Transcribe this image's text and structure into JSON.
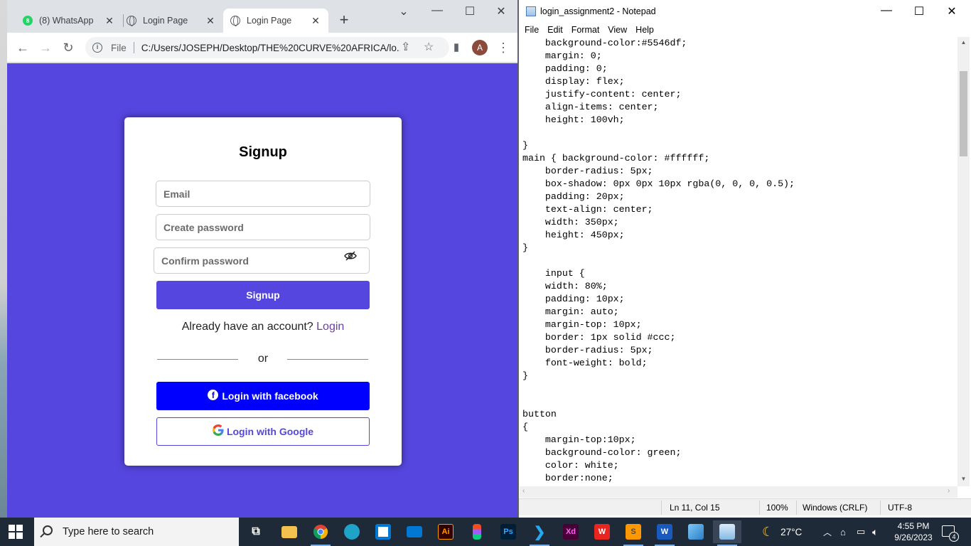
{
  "browser": {
    "tabs": [
      {
        "label": "(8) WhatsApp",
        "badge": "8"
      },
      {
        "label": "Login Page"
      },
      {
        "label": "Login Page"
      }
    ],
    "new_tab": "+",
    "url_scheme": "File",
    "url": "C:/Users/JOSEPH/Desktop/THE%20CURVE%20AFRICA/lo...",
    "avatar": "A"
  },
  "page": {
    "background": "#5546df",
    "title": "Signup",
    "email_placeholder": "Email",
    "password_placeholder": "Create password",
    "confirm_placeholder": "Confirm password",
    "signup_button": "Signup",
    "already_text": "Already have an account?",
    "login_link": "Login",
    "or_text": "or",
    "facebook_button": "Login with facebook",
    "google_button": "Login with Google",
    "facebook_color": "#0000ff"
  },
  "notepad": {
    "title": "login_assignment2 - Notepad",
    "menu": [
      "File",
      "Edit",
      "Format",
      "View",
      "Help"
    ],
    "content": "    background-color:#5546df;\n    margin: 0;\n    padding: 0;\n    display: flex;\n    justify-content: center;\n    align-items: center;\n    height: 100vh;\n\n}\nmain { background-color: #ffffff;\n    border-radius: 5px;\n    box-shadow: 0px 0px 10px rgba(0, 0, 0, 0.5);\n    padding: 20px;\n    text-align: center;\n    width: 350px;\n    height: 450px;\n}\n\n    input {\n    width: 80%;\n    padding: 10px;\n    margin: auto;\n    margin-top: 10px;\n    border: 1px solid #ccc;\n    border-radius: 5px;\n    font-weight: bold;\n}\n\n\nbutton\n{\n    margin-top:10px;\n    background-color: green;\n    color: white;\n    border:none;",
    "status": {
      "position": "Ln 11, Col 15",
      "zoom": "100%",
      "line_endings": "Windows (CRLF)",
      "encoding": "UTF-8"
    }
  },
  "taskbar": {
    "search_placeholder": "Type here to search",
    "temperature": "27°C",
    "time": "4:55 PM",
    "date": "9/26/2023",
    "notifications": "4",
    "apps": [
      "task-view",
      "file-explorer",
      "chrome",
      "edge",
      "store",
      "mail",
      "illustrator",
      "figma",
      "photoshop",
      "vscode",
      "xd",
      "wps",
      "sublime",
      "word",
      "photos",
      "notepad"
    ]
  }
}
